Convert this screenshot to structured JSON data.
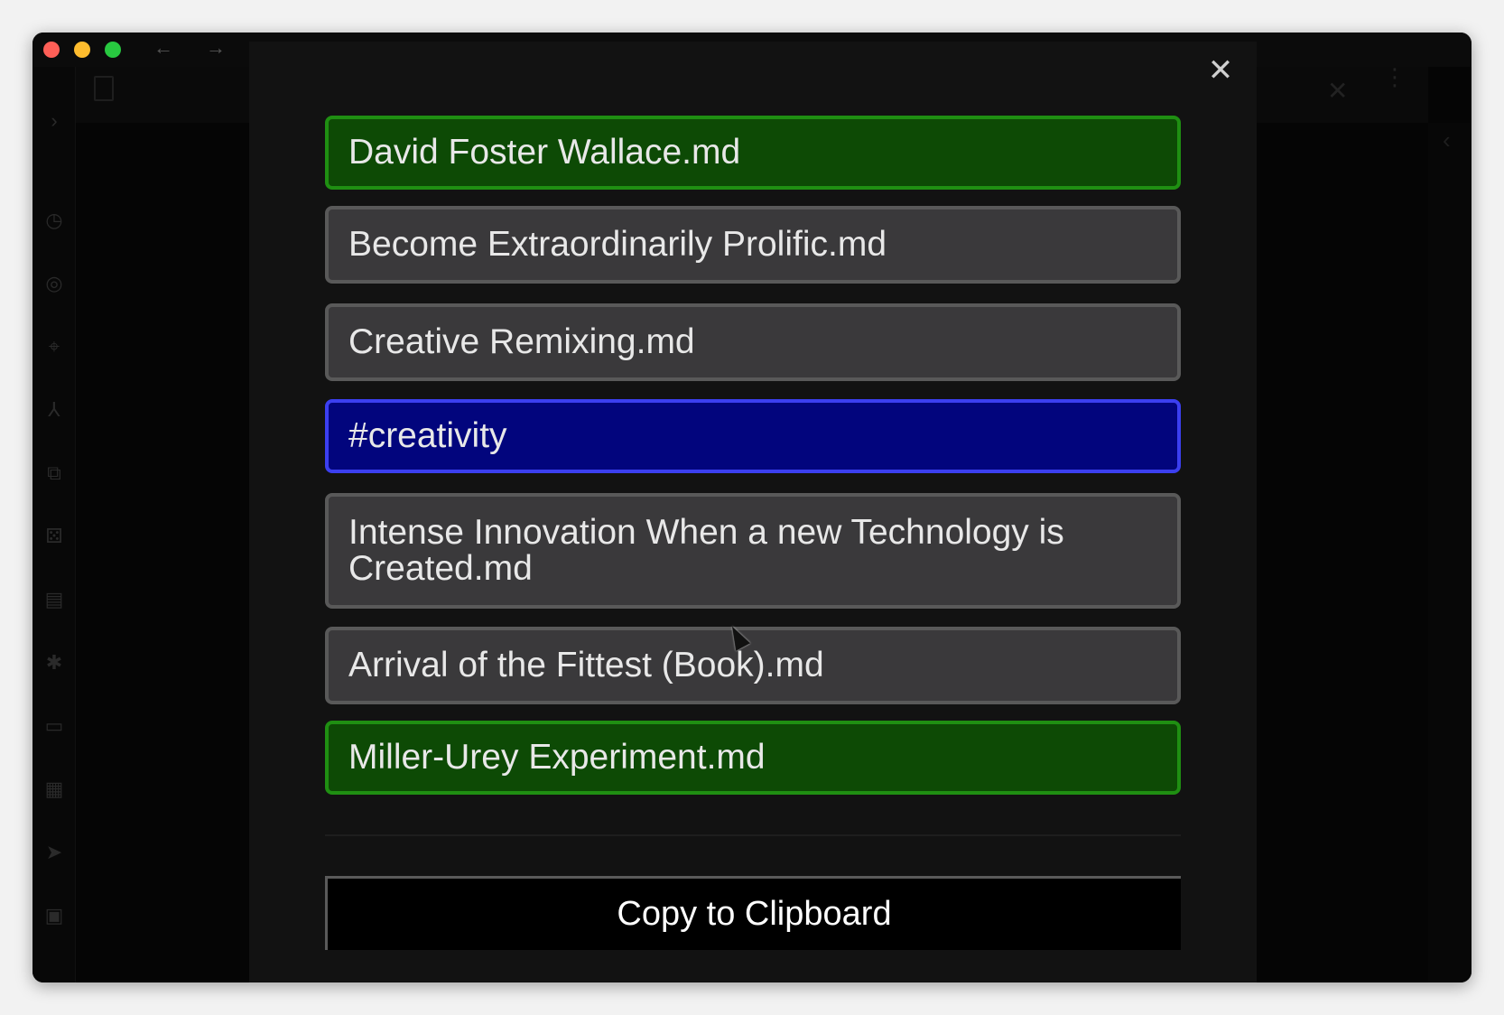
{
  "window": {
    "title": "",
    "nav": {
      "back_icon": "←",
      "forward_icon": "→"
    }
  },
  "sidebar": {
    "icons": [
      "chevron-right-icon",
      "alarm-icon",
      "target-icon",
      "location-pin-icon",
      "fork-icon",
      "link-icon",
      "dice-icon",
      "note-icon",
      "graph-icon",
      "folder-icon",
      "calendar-icon",
      "send-icon",
      "image-icon"
    ]
  },
  "modal": {
    "close_label": "✕",
    "items": [
      {
        "label": "David Foster Wallace.md",
        "style": "green"
      },
      {
        "label": "Become Extraordinarily Prolific.md",
        "style": "gray"
      },
      {
        "label": "Creative Remixing.md",
        "style": "gray"
      },
      {
        "label": "#creativity",
        "style": "blue"
      },
      {
        "label": "Intense Innovation When a new Technology is Created.md",
        "style": "gray"
      },
      {
        "label": "Arrival of the Fittest (Book).md",
        "style": "gray"
      },
      {
        "label": "Miller-Urey Experiment.md",
        "style": "green"
      }
    ],
    "copy_button_label": "Copy to Clipboard"
  },
  "colors": {
    "green_fill": "#0d4a05",
    "green_border": "#1f8f12",
    "blue_fill": "#02057d",
    "blue_border": "#3b3ff0",
    "gray_fill": "#3a393b",
    "gray_border": "#595959"
  }
}
